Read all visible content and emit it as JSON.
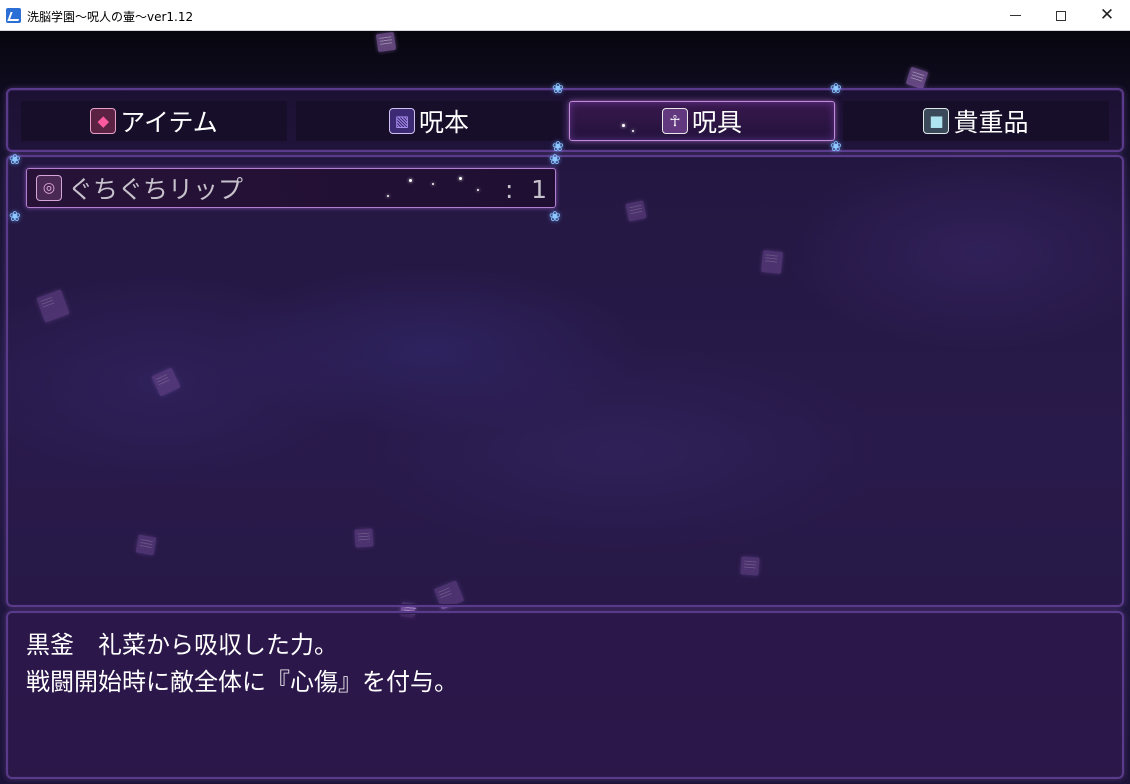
{
  "window": {
    "title": "洗脳学園～呪人の壷～ver1.12",
    "minimize_glyph": "—",
    "maximize_glyph": "☐",
    "close_glyph": "✕"
  },
  "tabs": [
    {
      "label": "アイテム",
      "icon": "gem-icon",
      "selected": false
    },
    {
      "label": "呪本",
      "icon": "book-icon",
      "selected": false
    },
    {
      "label": "呪具",
      "icon": "curse-tool-icon",
      "selected": true
    },
    {
      "label": "貴重品",
      "icon": "valuable-icon",
      "selected": false
    }
  ],
  "items": [
    {
      "name": "ぐちぐちリップ",
      "colon": ":",
      "count": "1",
      "icon": "lips-icon"
    }
  ],
  "description": {
    "line1": "黒釜　礼菜から吸収した力。",
    "line2": "戦闘開始時に敵全体に『心傷』を付与。"
  },
  "colors": {
    "panel_border": "#5a3a8a",
    "selected_border": "#c28ad8",
    "text": "#ffffff",
    "item_text": "#c6c2cc"
  }
}
